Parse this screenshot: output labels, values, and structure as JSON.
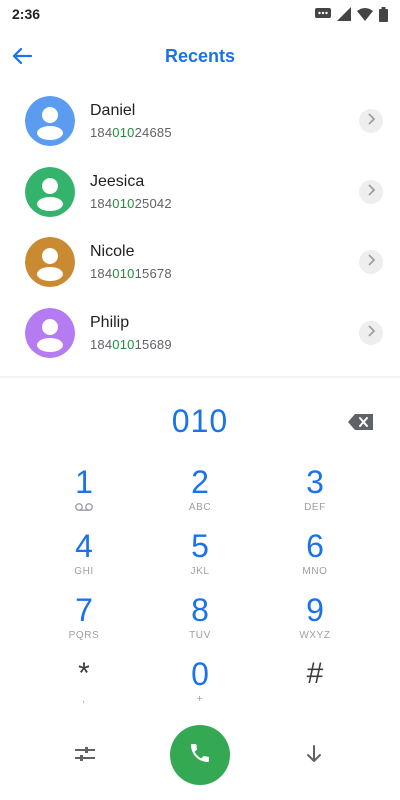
{
  "status_bar": {
    "time": "2:36",
    "icons": [
      "message-icon",
      "signal-icon",
      "wifi-icon",
      "battery-icon"
    ]
  },
  "app_bar": {
    "title": "Recents",
    "back_icon": "arrow-left-icon"
  },
  "colors": {
    "accent": "#1a73e8",
    "match_green": "#1e8e3e",
    "call_green": "#34a853"
  },
  "contacts": [
    {
      "name": "Daniel",
      "number_prefix": "184",
      "number_match": "010",
      "number_suffix": "24685",
      "avatar_color": "#5b9cf0"
    },
    {
      "name": "Jeesica",
      "number_prefix": "184",
      "number_match": "010",
      "number_suffix": "25042",
      "avatar_color": "#33b36b"
    },
    {
      "name": "Nicole",
      "number_prefix": "184",
      "number_match": "010",
      "number_suffix": "15678",
      "avatar_color": "#c98a32"
    },
    {
      "name": "Philip",
      "number_prefix": "184",
      "number_match": "010",
      "number_suffix": "15689",
      "avatar_color": "#b57bf0"
    }
  ],
  "dial": {
    "entered": "010",
    "backspace_icon": "backspace-icon"
  },
  "keypad": [
    {
      "digit": "1",
      "letters": "",
      "sub_icon": "voicemail-icon"
    },
    {
      "digit": "2",
      "letters": "ABC"
    },
    {
      "digit": "3",
      "letters": "DEF"
    },
    {
      "digit": "4",
      "letters": "GHI"
    },
    {
      "digit": "5",
      "letters": "JKL"
    },
    {
      "digit": "6",
      "letters": "MNO"
    },
    {
      "digit": "7",
      "letters": "PQRS"
    },
    {
      "digit": "8",
      "letters": "TUV"
    },
    {
      "digit": "9",
      "letters": "WXYZ"
    },
    {
      "digit": "*",
      "letters": ","
    },
    {
      "digit": "0",
      "letters": "+"
    },
    {
      "digit": "#",
      "letters": ""
    }
  ],
  "actions": {
    "tune_icon": "tune-icon",
    "call_icon": "phone-icon",
    "collapse_icon": "arrow-down-icon"
  }
}
